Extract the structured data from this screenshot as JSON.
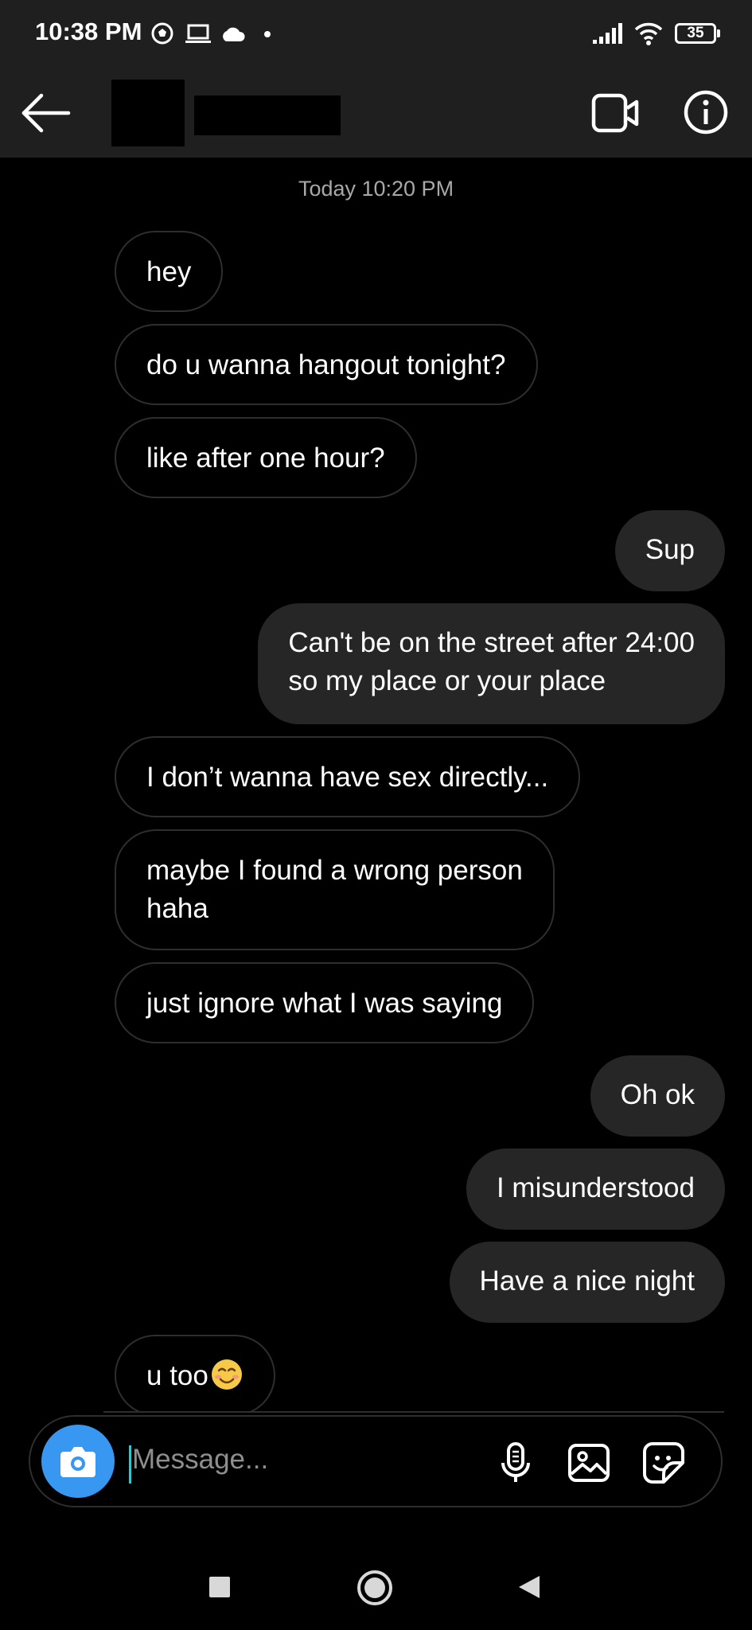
{
  "status_bar": {
    "time": "10:38 PM",
    "battery": "35",
    "icons": [
      "soccer-ball-icon",
      "laptop-icon",
      "cloud-icon",
      "dot-icon",
      "signal-icon",
      "wifi-icon",
      "battery-icon"
    ]
  },
  "header": {
    "back_icon": "arrow-left-icon",
    "video_icon": "video-call-icon",
    "info_icon": "info-icon"
  },
  "chat": {
    "timestamp": "Today 10:20 PM",
    "messages": [
      {
        "side": "in",
        "text": "hey"
      },
      {
        "side": "in",
        "text": "do u wanna hangout tonight?"
      },
      {
        "side": "in",
        "text": "like after one hour?"
      },
      {
        "side": "out",
        "text": "Sup"
      },
      {
        "side": "out",
        "line1": "Can't be on the street after 24:00",
        "line2": "so my place or your place"
      },
      {
        "side": "in",
        "text": "I don’t wanna have sex directly..."
      },
      {
        "side": "in",
        "line1": "maybe I found a wrong person",
        "line2": "haha"
      },
      {
        "side": "in",
        "text": "just ignore what I was saying"
      },
      {
        "side": "out",
        "text": "Oh ok"
      },
      {
        "side": "out",
        "text": "I misunderstood"
      },
      {
        "side": "out",
        "text": "Have a nice night"
      },
      {
        "side": "in",
        "text": "u too",
        "emoji": "smiling-face-emoji"
      }
    ]
  },
  "composer": {
    "placeholder": "Message...",
    "camera_icon": "camera-icon",
    "mic_icon": "microphone-icon",
    "gallery_icon": "image-icon",
    "sticker_icon": "sticker-icon",
    "accent_color": "#3897f0"
  },
  "nav": {
    "icons": [
      "recents-square-icon",
      "home-circle-icon",
      "back-triangle-icon"
    ]
  }
}
